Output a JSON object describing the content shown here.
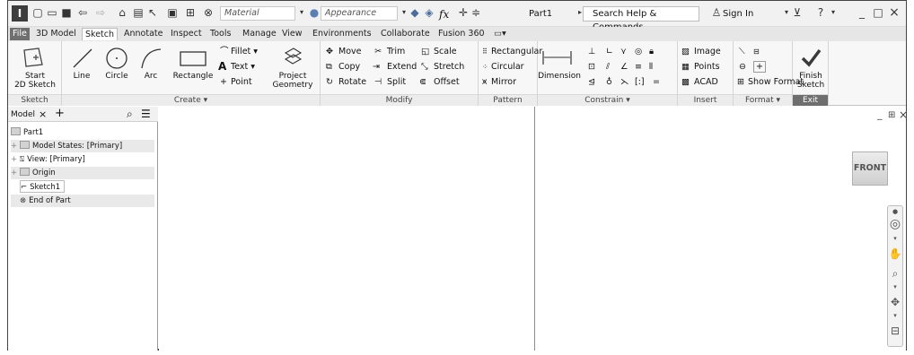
{
  "titlebar": {
    "app_letter": "I",
    "material": "Material",
    "appearance": "Appearance",
    "fx": "fx",
    "document": "Part1",
    "search_placeholder": "Search Help & Commands...",
    "sign_in": "Sign In"
  },
  "tabs": [
    "File",
    "3D Model",
    "Sketch",
    "Annotate",
    "Inspect",
    "Tools",
    "Manage",
    "View",
    "Environments",
    "Collaborate",
    "Fusion 360"
  ],
  "active_tab": "Sketch",
  "ribbon": {
    "sketch_panel": {
      "title": "Sketch",
      "start_line1": "Start",
      "start_line2": "2D Sketch"
    },
    "create_panel": {
      "title": "Create ▾",
      "line": "Line",
      "circle": "Circle",
      "arc": "Arc",
      "rectangle": "Rectangle",
      "fillet": "Fillet ▾",
      "text": "Text ▾",
      "point": "Point",
      "project_line1": "Project",
      "project_line2": "Geometry"
    },
    "modify_panel": {
      "title": "Modify",
      "move": "Move",
      "trim": "Trim",
      "scale": "Scale",
      "copy": "Copy",
      "extend": "Extend",
      "stretch": "Stretch",
      "rotate": "Rotate",
      "split": "Split",
      "offset": "Offset"
    },
    "pattern_panel": {
      "title": "Pattern",
      "rectangular": "Rectangular",
      "circular": "Circular",
      "mirror": "Mirror"
    },
    "constrain_panel": {
      "title": "Constrain ▾",
      "dimension": "Dimension"
    },
    "insert_panel": {
      "title": "Insert",
      "image": "Image",
      "points": "Points",
      "acad": "ACAD"
    },
    "format_panel": {
      "title": "Format ▾",
      "show_format": "Show Format"
    },
    "exit_panel": {
      "title": "Exit",
      "finish_line1": "Finish",
      "finish_line2": "Sketch"
    }
  },
  "browser": {
    "tab": "Model",
    "rows": {
      "part": "Part1",
      "model_states": "Model States: [Primary]",
      "view": "View: [Primary]",
      "origin": "Origin",
      "sketch": "Sketch1",
      "end": "End of Part"
    }
  },
  "viewcube": "FRONT"
}
